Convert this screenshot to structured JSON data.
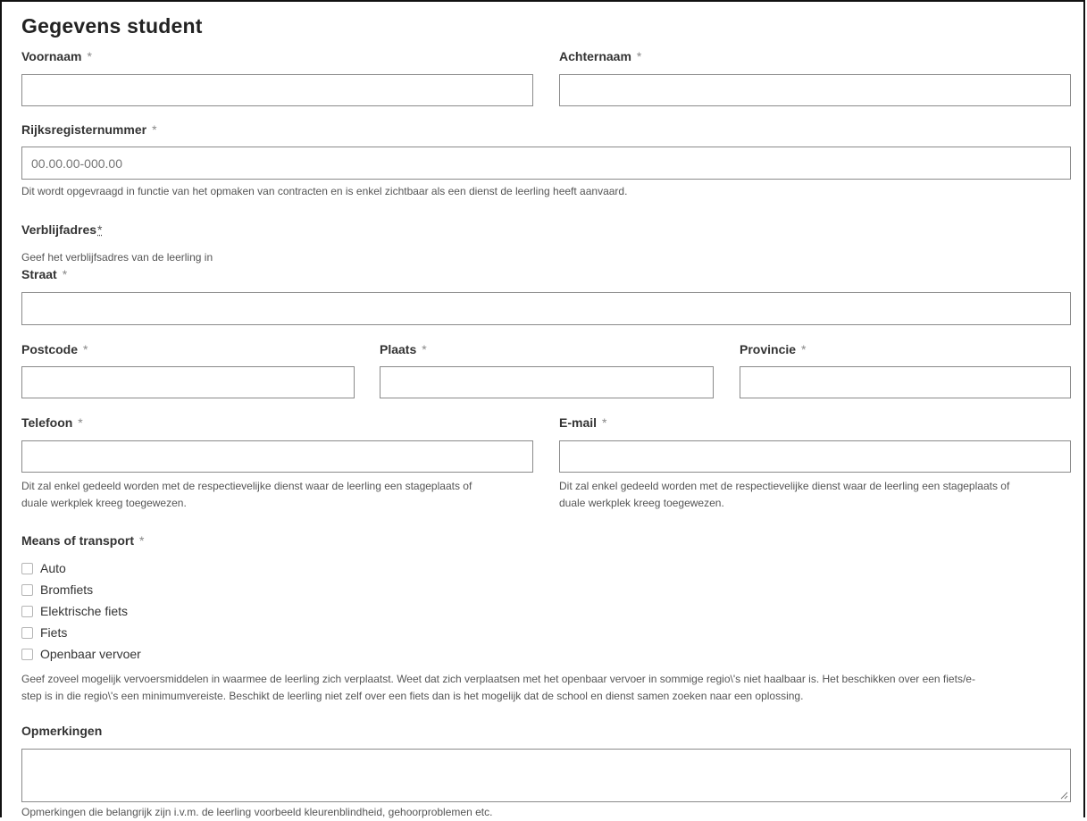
{
  "form": {
    "title": "Gegevens student",
    "required_mark": "*",
    "fields": {
      "first_name": {
        "label": "Voornaam",
        "value": ""
      },
      "last_name": {
        "label": "Achternaam",
        "value": ""
      },
      "national_id": {
        "label": "Rijksregisternummer",
        "placeholder": "00.00.00-000.00",
        "help": "Dit wordt opgevraagd in functie van het opmaken van contracten en is enkel zichtbaar als een dienst de leerling heeft aanvaard."
      },
      "address": {
        "label": "Verblijfadres",
        "help": "Geef het verblijfsadres van de leerling in",
        "street": {
          "label": "Straat",
          "value": ""
        },
        "postcode": {
          "label": "Postcode",
          "value": ""
        },
        "city": {
          "label": "Plaats",
          "value": ""
        },
        "province": {
          "label": "Provincie",
          "value": ""
        }
      },
      "phone": {
        "label": "Telefoon",
        "help_line1": "Dit zal enkel gedeeld worden met de respectievelijke dienst waar de leerling een stageplaats of",
        "help_line2": "duale werkplek kreeg toegewezen."
      },
      "email": {
        "label": "E-mail",
        "help_line1": "Dit zal enkel gedeeld worden met de respectievelijke dienst waar de leerling een stageplaats of",
        "help_line2": "duale werkplek kreeg toegewezen."
      },
      "transport": {
        "label": "Means of transport",
        "options": [
          "Auto",
          "Bromfiets",
          "Elektrische fiets",
          "Fiets",
          "Openbaar vervoer"
        ],
        "checked": [
          false,
          false,
          false,
          false,
          false
        ],
        "help_line1": "Geef zoveel mogelijk vervoersmiddelen in waarmee de leerling zich verplaatst. Weet dat zich verplaatsen met het openbaar vervoer in sommige regio\\'s niet haalbaar is. Het beschikken over een fiets/e-",
        "help_line2": "step is in die regio\\'s een minimumvereiste. Beschikt de leerling niet zelf over een fiets dan is het mogelijk dat de school en dienst samen zoeken naar een oplossing."
      },
      "remarks": {
        "label": "Opmerkingen",
        "help": "Opmerkingen die belangrijk zijn i.v.m. de leerling voorbeeld kleurenblindheid, gehoorproblemen etc."
      }
    }
  }
}
